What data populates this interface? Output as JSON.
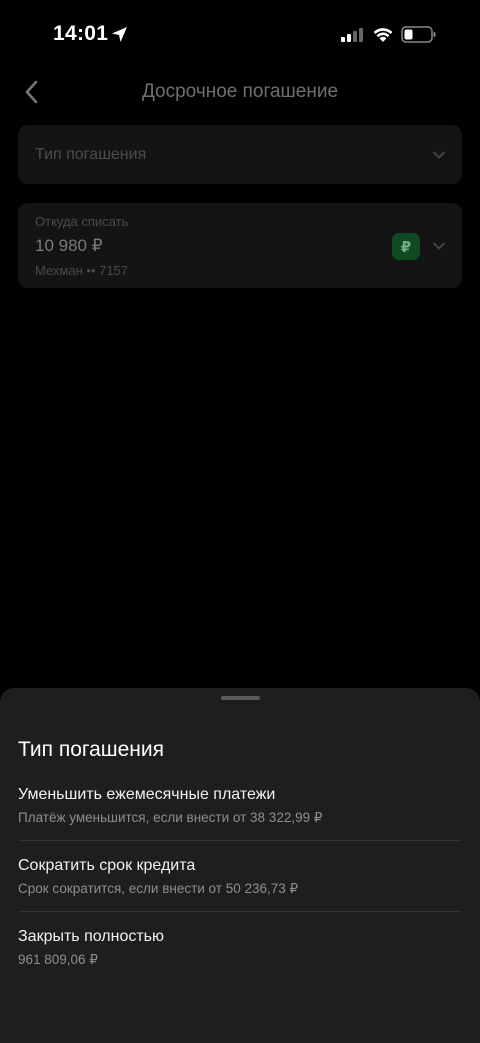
{
  "status_bar": {
    "time": "14:01"
  },
  "header": {
    "title": "Досрочное погашение"
  },
  "type_field": {
    "placeholder": "Тип погашения"
  },
  "source_field": {
    "label": "Откуда списать",
    "amount": "10 980 ₽",
    "account": "Мехман •• 7157",
    "badge": "₽"
  },
  "sheet": {
    "title": "Тип погашения",
    "options": [
      {
        "title": "Уменьшить ежемесячные платежи",
        "subtitle": "Платёж уменьшится, если внести от 38 322,99 ₽"
      },
      {
        "title": "Сократить срок кредита",
        "subtitle": "Срок сократится, если внести от 50 236,73 ₽"
      },
      {
        "title": "Закрыть полностью",
        "subtitle": "961 809,06 ₽"
      }
    ]
  },
  "colors": {
    "sheet_bg": "#1e1e1e",
    "badge_green": "#0f4a22",
    "page_bg": "#000000"
  }
}
